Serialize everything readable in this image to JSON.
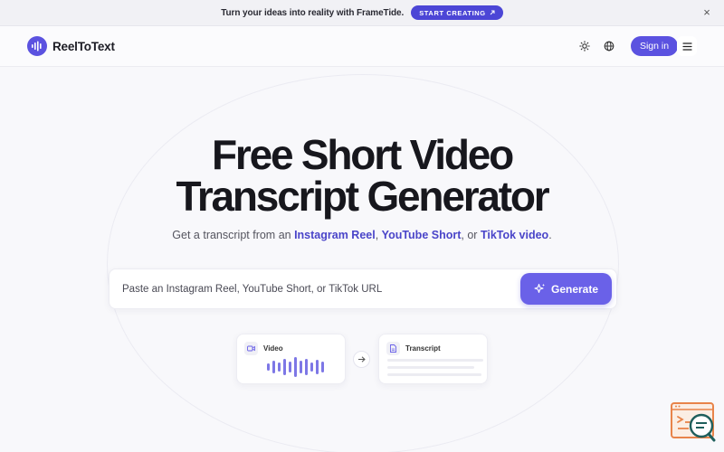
{
  "announcement": {
    "text": "Turn your ideas into reality with FrameTide.",
    "button_label": "START CREATING",
    "close_symbol": "×"
  },
  "header": {
    "brand": "ReelToText",
    "signin_label": "Sign in",
    "icons": [
      "sun-icon",
      "globe-icon",
      "menu-icon"
    ]
  },
  "hero": {
    "title_line1": "Free Short Video",
    "title_line2": "Transcript Generator",
    "sub_prefix": "Get a transcript from an ",
    "link_instagram": "Instagram Reel",
    "sep1": ", ",
    "link_youtube": "YouTube Short",
    "sep2": ", or ",
    "link_tiktok": "TikTok video",
    "sub_suffix": "."
  },
  "form": {
    "placeholder": "Paste an Instagram Reel, YouTube Short, or TikTok URL",
    "value": "",
    "generate_label": "Generate"
  },
  "illustration": {
    "video_label": "Video",
    "transcript_label": "Transcript"
  },
  "colors": {
    "accent": "#5b52e0",
    "button": "#6a61e8",
    "announce_btn": "#4c46d6",
    "link": "#4a45c9",
    "chat_widget": "#e8844a",
    "chat_bubble": "#1f5f5c"
  }
}
